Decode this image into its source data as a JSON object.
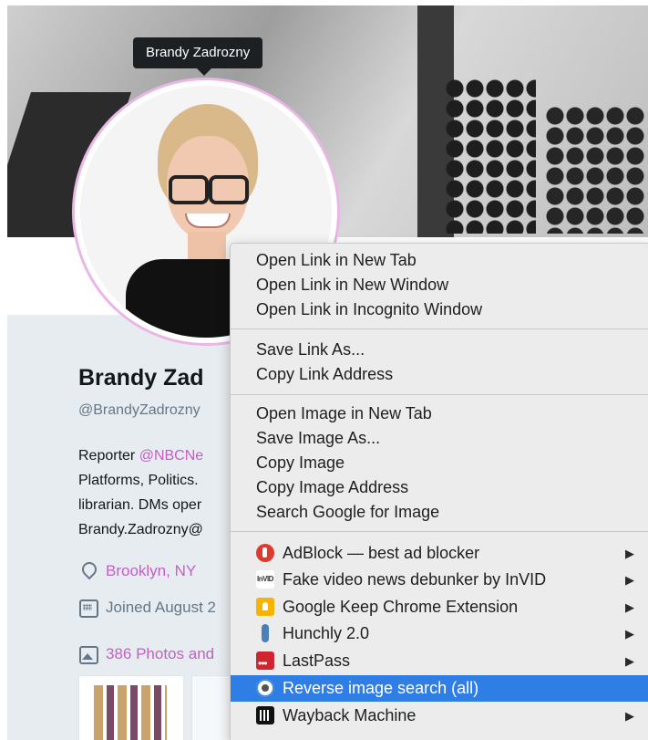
{
  "profile": {
    "tooltip": "Brandy Zadrozny",
    "name": "Brandy Zad",
    "handle": "@BrandyZadrozny",
    "bio_line1_prefix": "Reporter ",
    "bio_line1_link": "@NBCNe",
    "bio_line2": "Platforms, Politics.",
    "bio_line3": "librarian. DMs oper",
    "bio_line4": "Brandy.Zadrozny@",
    "location": "Brooklyn, NY",
    "joined": "Joined August 2",
    "photos": "386 Photos and",
    "accent_color": "#c45fc6"
  },
  "menu": {
    "items": [
      {
        "label": "Open Link in New Tab"
      },
      {
        "label": "Open Link in New Window"
      },
      {
        "label": "Open Link in Incognito Window"
      },
      {
        "label": "Save Link As..."
      },
      {
        "label": "Copy Link Address"
      },
      {
        "label": "Open Image in New Tab"
      },
      {
        "label": "Save Image As..."
      },
      {
        "label": "Copy Image"
      },
      {
        "label": "Copy Image Address"
      },
      {
        "label": "Search Google for Image"
      }
    ],
    "extensions": [
      {
        "label": "AdBlock — best ad blocker",
        "icon": "adblock-icon",
        "submenu": true
      },
      {
        "label": "Fake video news debunker by InVID",
        "icon": "invid-icon",
        "icon_text": "InVID",
        "submenu": true
      },
      {
        "label": "Google Keep Chrome Extension",
        "icon": "google-keep-icon",
        "submenu": true
      },
      {
        "label": "Hunchly 2.0",
        "icon": "hunchly-icon",
        "submenu": true
      },
      {
        "label": "LastPass",
        "icon": "lastpass-icon",
        "submenu": true
      },
      {
        "label": "Reverse image search (all)",
        "icon": "reverse-image-search-icon",
        "submenu": false,
        "selected": true
      },
      {
        "label": "Wayback Machine",
        "icon": "wayback-machine-icon",
        "submenu": true
      }
    ],
    "submenu_arrow": "▶",
    "selection_color": "#2f7ee6"
  }
}
